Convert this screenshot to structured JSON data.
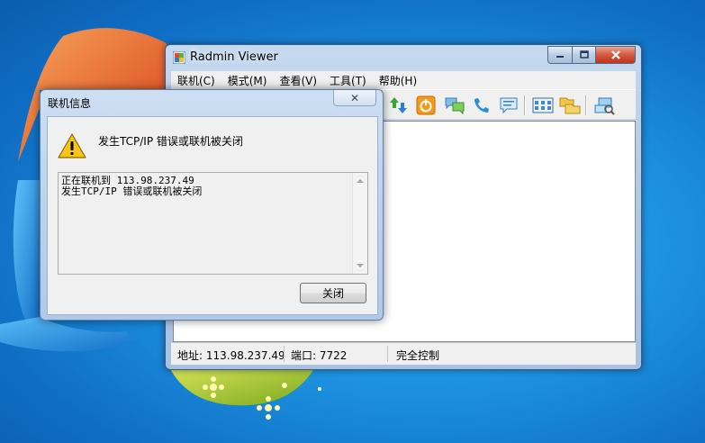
{
  "main_window": {
    "title": "Radmin Viewer",
    "menu": [
      {
        "label": "联机(C)"
      },
      {
        "label": "模式(M)"
      },
      {
        "label": "查看(V)"
      },
      {
        "label": "工具(T)"
      },
      {
        "label": "帮助(H)"
      }
    ],
    "toolbar": [
      {
        "name": "connect-icon"
      },
      {
        "name": "full-control-icon"
      },
      {
        "name": "view-only-icon"
      },
      {
        "name": "telnet-icon"
      },
      {
        "name": "file-transfer-icon"
      },
      {
        "name": "transfer-arrows-icon"
      },
      {
        "name": "shutdown-icon"
      },
      {
        "name": "text-chat-icon"
      },
      {
        "name": "voice-chat-icon"
      },
      {
        "name": "send-message-icon"
      },
      {
        "name": "address-book-icon"
      },
      {
        "name": "folders-icon"
      },
      {
        "name": "network-scan-icon"
      }
    ],
    "status": {
      "address": "地址: 113.98.237.49",
      "port": "端口: 7722",
      "mode": "完全控制"
    }
  },
  "dialog": {
    "title": "联机信息",
    "message": "发生TCP/IP 错误或联机被关闭",
    "log_lines": [
      "正在联机到 113.98.237.49",
      "发生TCP/IP 错误或联机被关闭"
    ],
    "close_button": "关闭",
    "close_glyph": "✕"
  },
  "colors": {
    "desktop_blue": "#1d93e0",
    "title_bar": "#b4cbe6",
    "warning_yellow": "#f5c518"
  }
}
